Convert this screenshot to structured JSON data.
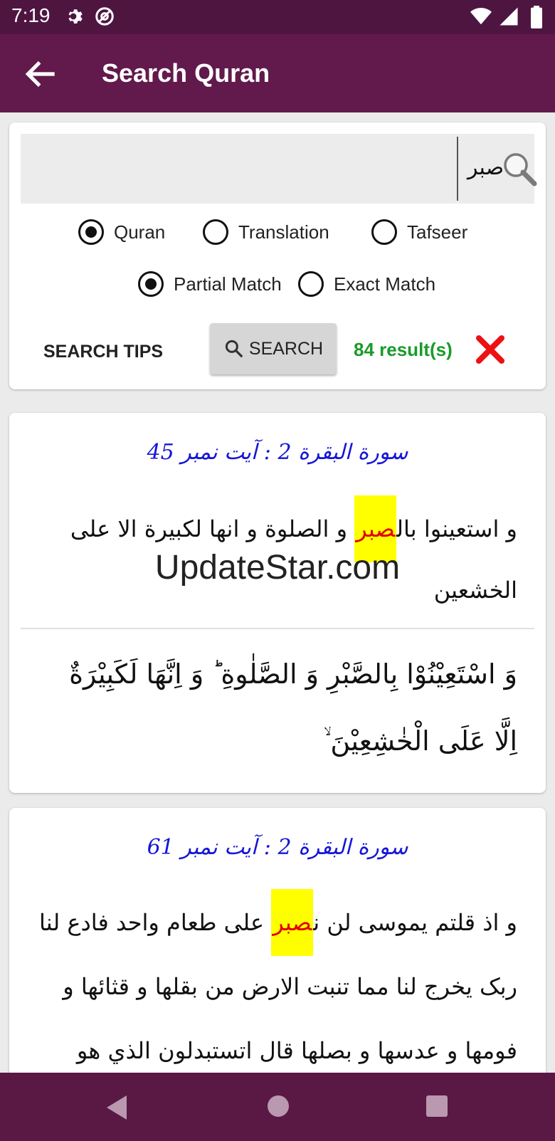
{
  "status": {
    "time": "7:19",
    "icons": [
      "gear-icon",
      "at-sign-icon",
      "wifi-icon",
      "signal-icon",
      "battery-icon"
    ]
  },
  "app_bar": {
    "title": "Search Quran",
    "back_icon": "arrow-left-icon"
  },
  "search": {
    "query": "صبر",
    "scope_options": [
      {
        "label": "Quran",
        "selected": true
      },
      {
        "label": "Translation",
        "selected": false
      },
      {
        "label": "Tafseer",
        "selected": false
      }
    ],
    "match_options": [
      {
        "label": "Partial Match",
        "selected": true
      },
      {
        "label": "Exact Match",
        "selected": false
      }
    ],
    "tips_label": "SEARCH TIPS",
    "button_label": "SEARCH",
    "results_text": "84 result(s)"
  },
  "results": [
    {
      "header": "سورة البقرة 2 : آیت نمبر 45",
      "text_before": "و استعینوا بال",
      "highlight": "صبر",
      "text_after": " و الصلوة و انھا لکبیرة الا علی الخشعین",
      "arabic": "وَ اسْتَعِیْنُوْا بِالصَّبْرِ وَ الصَّلٰوةِ ؕ وَ اِنَّهَا لَكَبِیْرَةٌ اِلَّا عَلَى الْخٰشِعِیْنَ ۙ"
    },
    {
      "header": "سورة البقرة 2 : آیت نمبر 61",
      "text_before": "و اذ قلتم یموسی لن ن",
      "highlight": "صبر",
      "text_after": " علی طعام واحد فادع لنا ربک یخرج لنا مما تنبت الارض من بقلها و قثائها و فومها و عدسها و بصلها قال اتستبدلون الذي هو"
    }
  ],
  "watermark": "UpdateStar.com",
  "colors": {
    "app_bar": "#611a4b",
    "highlight": "#ffff00",
    "highlight_text": "#e00000",
    "results": "#1a9b2a",
    "sura_header": "#1515d8"
  }
}
